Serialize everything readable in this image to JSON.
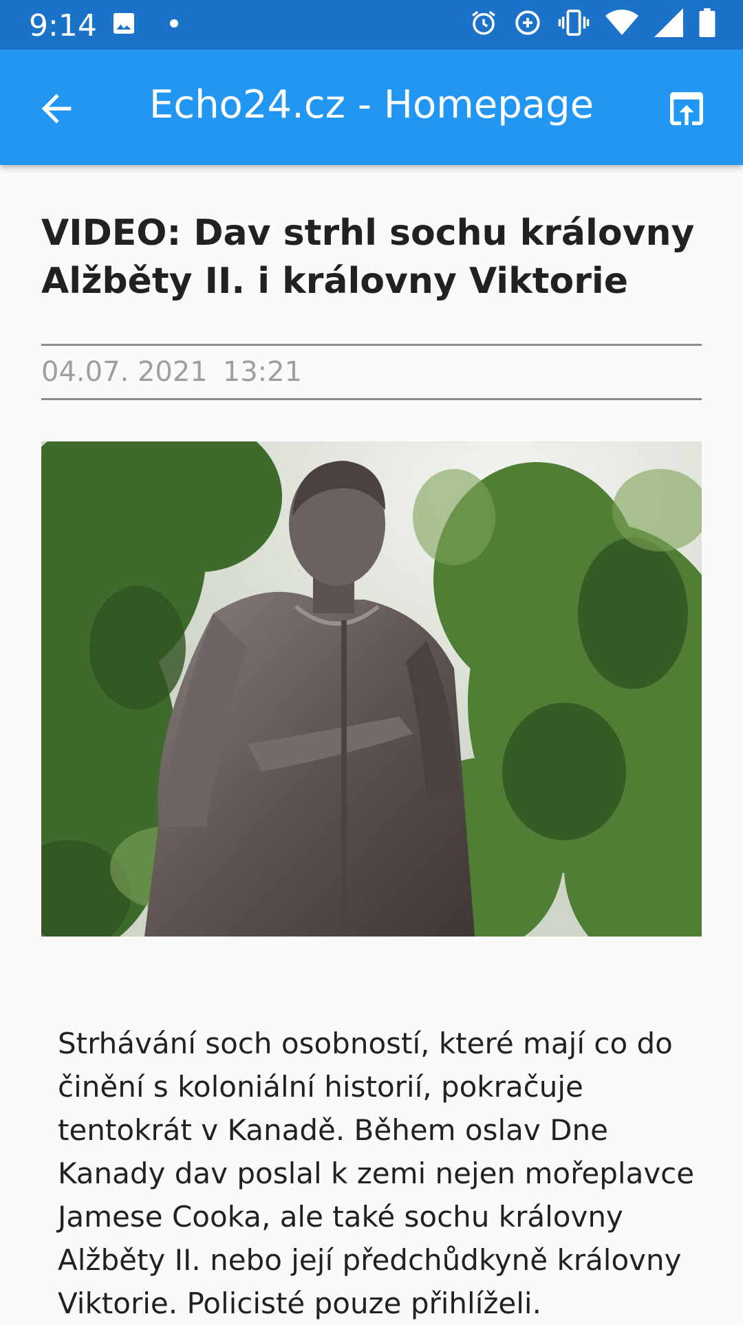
{
  "status_bar": {
    "time": "9:14",
    "left_icons": [
      "image-icon",
      "dot-icon"
    ],
    "right_icons": [
      "alarm-icon",
      "data-saver-icon",
      "vibrate-icon",
      "wifi-icon",
      "signal-icon",
      "battery-icon"
    ]
  },
  "app_bar": {
    "title": "Echo24.cz - Homepage",
    "back_icon": "arrow-left-icon",
    "share_icon": "open-external-icon",
    "color": "#2196f3"
  },
  "article": {
    "headline": "VIDEO: Dav strhl sochu královny Alžběty II. i královny Viktorie",
    "date": "04.07. 2021",
    "time": "13:21",
    "body": "Strhávání soch osobností, které mají co do činění s koloniální historií, pokračuje tentokrát v Kanadě. Během oslav Dne Kanady dav poslal k zemi nejen mořeplavce Jamese Cooka, ale také sochu královny Alžběty II. nebo její předchůdkyně královny Viktorie. Policisté pouze přihlíželi."
  }
}
